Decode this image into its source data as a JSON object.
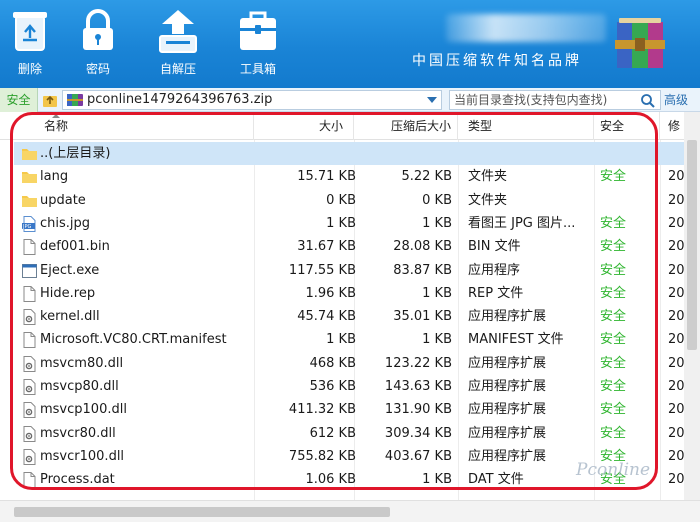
{
  "toolbar": {
    "buttons": [
      {
        "label": "删除",
        "icon": "recycle-bin-icon"
      },
      {
        "label": "密码",
        "icon": "padlock-icon"
      },
      {
        "label": "自解压",
        "icon": "self-extract-icon"
      },
      {
        "label": "工具箱",
        "icon": "toolbox-icon"
      }
    ],
    "slogan": "中国压缩软件知名品牌",
    "logo": "winrar-books-icon",
    "background": "#1a84d6"
  },
  "address": {
    "safe_tag": "安全",
    "path": "pconline1479264396763.zip",
    "search_placeholder": "当前目录查找(支持包内查找)",
    "advanced_label": "高级"
  },
  "columns": {
    "name": "名称",
    "size": "大小",
    "compressed": "压缩后大小",
    "type": "类型",
    "safety": "安全",
    "modified": "修"
  },
  "files": [
    {
      "name": "..(上层目录)",
      "size": "",
      "compressed": "",
      "type": "",
      "safe": "",
      "mod": "",
      "icon": "folder-icon",
      "selected": true
    },
    {
      "name": "lang",
      "size": "15.71 KB",
      "compressed": "5.22 KB",
      "type": "文件夹",
      "safe": "安全",
      "mod": "20",
      "icon": "folder-icon"
    },
    {
      "name": "update",
      "size": "0 KB",
      "compressed": "0 KB",
      "type": "文件夹",
      "safe": "",
      "mod": "20",
      "icon": "folder-icon"
    },
    {
      "name": "chis.jpg",
      "size": "1 KB",
      "compressed": "1 KB",
      "type": "看图王 JPG 图片...",
      "safe": "安全",
      "mod": "20",
      "icon": "jpg-image-icon"
    },
    {
      "name": "def001.bin",
      "size": "31.67 KB",
      "compressed": "28.08 KB",
      "type": "BIN 文件",
      "safe": "安全",
      "mod": "20",
      "icon": "file-icon"
    },
    {
      "name": "Eject.exe",
      "size": "117.55 KB",
      "compressed": "83.87 KB",
      "type": "应用程序",
      "safe": "安全",
      "mod": "20",
      "icon": "exe-icon"
    },
    {
      "name": "Hide.rep",
      "size": "1.96 KB",
      "compressed": "1 KB",
      "type": "REP 文件",
      "safe": "安全",
      "mod": "20",
      "icon": "file-icon"
    },
    {
      "name": "kernel.dll",
      "size": "45.74 KB",
      "compressed": "35.01 KB",
      "type": "应用程序扩展",
      "safe": "安全",
      "mod": "20",
      "icon": "dll-icon"
    },
    {
      "name": "Microsoft.VC80.CRT.manifest",
      "size": "1 KB",
      "compressed": "1 KB",
      "type": "MANIFEST 文件",
      "safe": "安全",
      "mod": "20",
      "icon": "file-icon"
    },
    {
      "name": "msvcm80.dll",
      "size": "468 KB",
      "compressed": "123.22 KB",
      "type": "应用程序扩展",
      "safe": "安全",
      "mod": "20",
      "icon": "dll-icon"
    },
    {
      "name": "msvcp80.dll",
      "size": "536 KB",
      "compressed": "143.63 KB",
      "type": "应用程序扩展",
      "safe": "安全",
      "mod": "20",
      "icon": "dll-icon"
    },
    {
      "name": "msvcp100.dll",
      "size": "411.32 KB",
      "compressed": "131.90 KB",
      "type": "应用程序扩展",
      "safe": "安全",
      "mod": "20",
      "icon": "dll-icon"
    },
    {
      "name": "msvcr80.dll",
      "size": "612 KB",
      "compressed": "309.34 KB",
      "type": "应用程序扩展",
      "safe": "安全",
      "mod": "20",
      "icon": "dll-icon"
    },
    {
      "name": "msvcr100.dll",
      "size": "755.82 KB",
      "compressed": "403.67 KB",
      "type": "应用程序扩展",
      "safe": "安全",
      "mod": "20",
      "icon": "dll-icon"
    },
    {
      "name": "Process.dat",
      "size": "1.06 KB",
      "compressed": "1 KB",
      "type": "DAT 文件",
      "safe": "安全",
      "mod": "20",
      "icon": "file-icon"
    }
  ],
  "colors": {
    "safe_text": "#2fb52f",
    "selection": "#cfe5f8",
    "annotation": "#e0162a"
  },
  "watermark": "Pconline"
}
